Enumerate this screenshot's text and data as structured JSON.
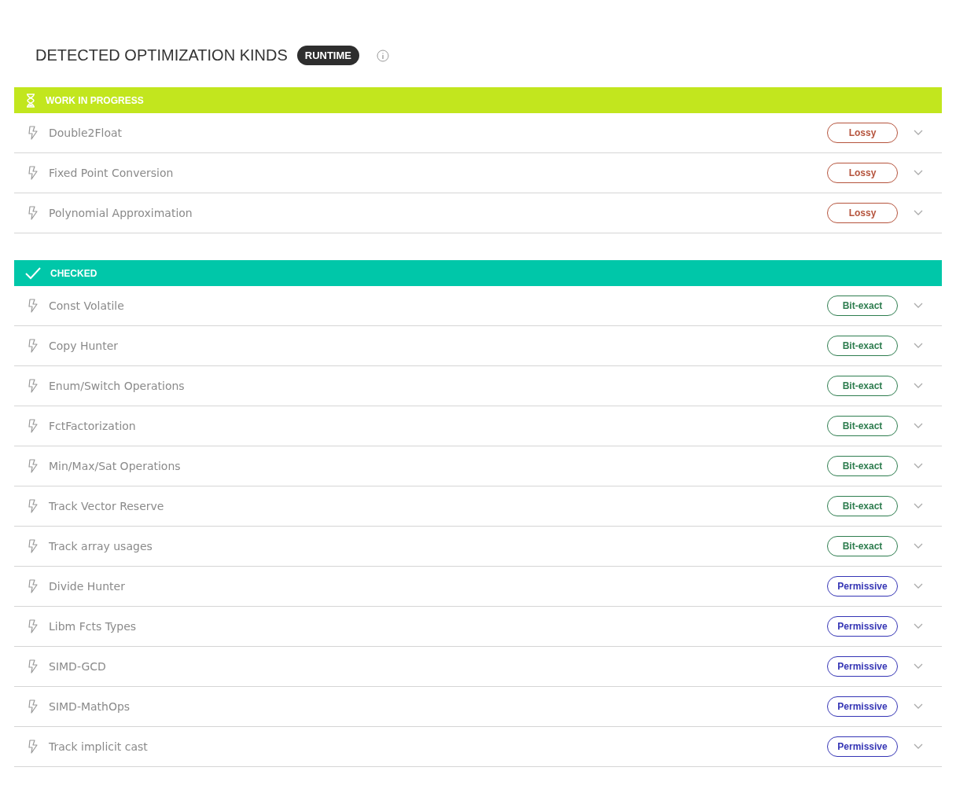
{
  "title": "DETECTED OPTIMIZATION KINDS",
  "title_badge": "RUNTIME",
  "sections": [
    {
      "kind": "progress",
      "label": "WORK IN PROGRESS",
      "items": [
        {
          "name": "Double2Float",
          "tag": "Lossy",
          "kind": "lossy"
        },
        {
          "name": "Fixed Point Conversion",
          "tag": "Lossy",
          "kind": "lossy"
        },
        {
          "name": "Polynomial Approximation",
          "tag": "Lossy",
          "kind": "lossy"
        }
      ]
    },
    {
      "kind": "checked",
      "label": "CHECKED",
      "items": [
        {
          "name": "Const Volatile",
          "tag": "Bit-exact",
          "kind": "exact"
        },
        {
          "name": "Copy Hunter",
          "tag": "Bit-exact",
          "kind": "exact"
        },
        {
          "name": "Enum/Switch Operations",
          "tag": "Bit-exact",
          "kind": "exact"
        },
        {
          "name": "FctFactorization",
          "tag": "Bit-exact",
          "kind": "exact"
        },
        {
          "name": "Min/Max/Sat Operations",
          "tag": "Bit-exact",
          "kind": "exact"
        },
        {
          "name": "Track Vector Reserve",
          "tag": "Bit-exact",
          "kind": "exact"
        },
        {
          "name": "Track array usages",
          "tag": "Bit-exact",
          "kind": "exact"
        },
        {
          "name": "Divide Hunter",
          "tag": "Permissive",
          "kind": "permissive"
        },
        {
          "name": "Libm Fcts Types",
          "tag": "Permissive",
          "kind": "permissive"
        },
        {
          "name": "SIMD-GCD",
          "tag": "Permissive",
          "kind": "permissive"
        },
        {
          "name": "SIMD-MathOps",
          "tag": "Permissive",
          "kind": "permissive"
        },
        {
          "name": "Track implicit cast",
          "tag": "Permissive",
          "kind": "permissive"
        }
      ]
    }
  ]
}
